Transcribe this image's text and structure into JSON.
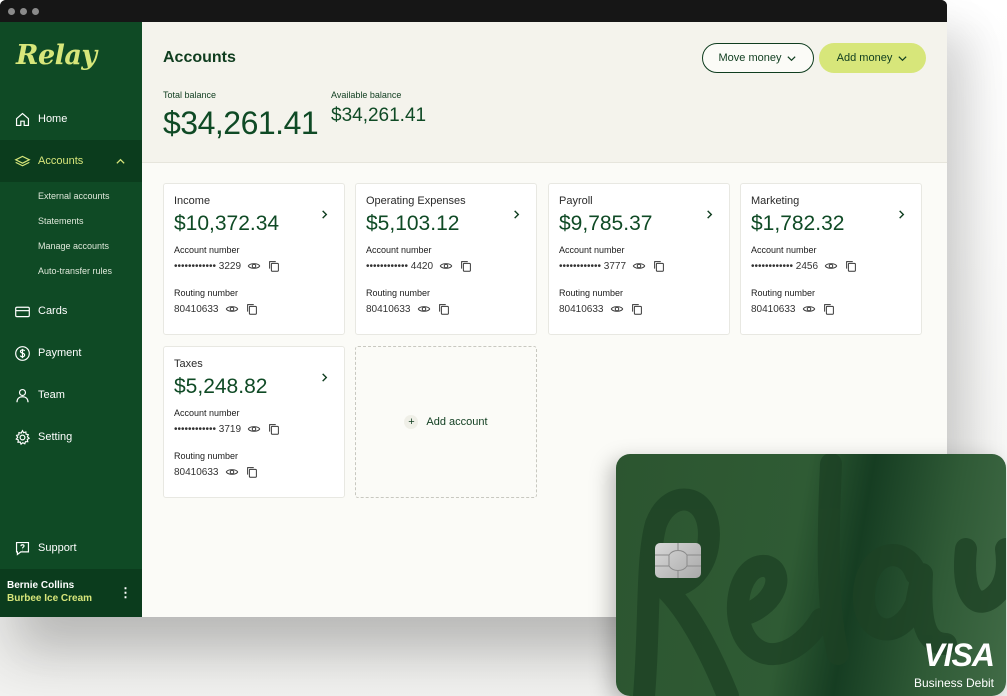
{
  "app": {
    "logo": "Relay"
  },
  "sidebar": {
    "items": [
      {
        "label": "Home"
      },
      {
        "label": "Accounts"
      },
      {
        "label": "Cards"
      },
      {
        "label": "Payment"
      },
      {
        "label": "Team"
      },
      {
        "label": "Setting"
      }
    ],
    "sub_items": [
      "External accounts",
      "Statements",
      "Manage accounts",
      "Auto-transfer rules"
    ],
    "support": "Support",
    "user": {
      "name": "Bernie Collins",
      "company": "Burbee Ice Cream"
    }
  },
  "header": {
    "title": "Accounts",
    "move_money": "Move money",
    "add_money": "Add money",
    "total_label": "Total balance",
    "total_value": "$34,261.41",
    "available_label": "Available balance",
    "available_value": "$34,261.41"
  },
  "accounts": [
    {
      "name": "Income",
      "balance": "$10,372.34",
      "account_label": "Account number",
      "account_masked": "•••••••••••• 3229",
      "routing_label": "Routing number",
      "routing": "80410633"
    },
    {
      "name": "Operating Expenses",
      "balance": "$5,103.12",
      "account_label": "Account number",
      "account_masked": "•••••••••••• 4420",
      "routing_label": "Routing number",
      "routing": "80410633"
    },
    {
      "name": "Payroll",
      "balance": "$9,785.37",
      "account_label": "Account number",
      "account_masked": "•••••••••••• 3777",
      "routing_label": "Routing number",
      "routing": "80410633"
    },
    {
      "name": "Marketing",
      "balance": "$1,782.32",
      "account_label": "Account number",
      "account_masked": "•••••••••••• 2456",
      "routing_label": "Routing number",
      "routing": "80410633"
    },
    {
      "name": "Taxes",
      "balance": "$5,248.82",
      "account_label": "Account number",
      "account_masked": "•••••••••••• 3719",
      "routing_label": "Routing number",
      "routing": "80410633"
    }
  ],
  "add_account": {
    "plus": "+",
    "label": "Add account"
  },
  "debit_card": {
    "brand": "VISA",
    "type": "Business Debit"
  },
  "colors": {
    "sidebar": "#0f4a25",
    "accent": "#d7e67a",
    "text_green": "#0f4a25"
  }
}
